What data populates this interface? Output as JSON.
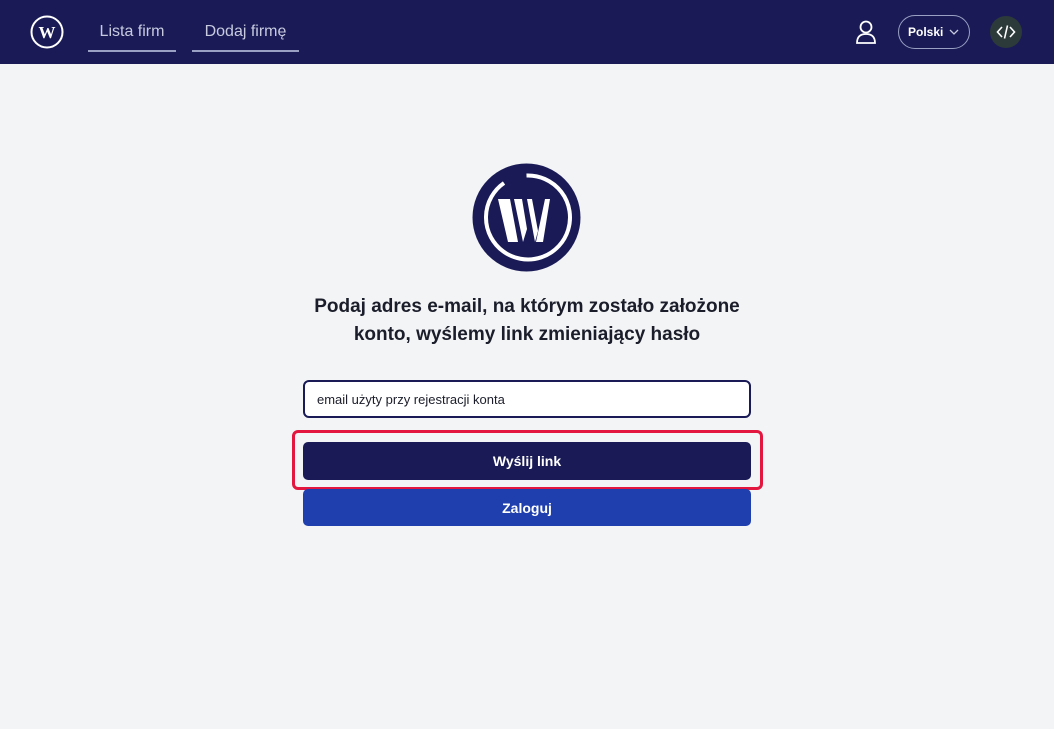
{
  "nav": {
    "logo_icon": "w-logo-icon",
    "links": [
      "Lista firm",
      "Dodaj firmę"
    ],
    "user_icon": "user-icon",
    "language": "Polski",
    "language_icon": "chevron-down-icon",
    "code_icon": "code-icon"
  },
  "main": {
    "logo_icon": "w-logo-icon",
    "heading_line1": "Podaj adres e-mail, na którym zostało założone",
    "heading_line2": "konto, wyślemy link zmieniający hasło",
    "email_value": "email użyty przy rejestracji konta",
    "send_button": "Wyślij link",
    "login_button": "Zaloguj"
  },
  "colors": {
    "navbar": "#1a1b56",
    "primary_button": "#1a1b56",
    "secondary_button": "#1f3fae",
    "highlight": "#e3163f",
    "background": "#f3f4f6"
  }
}
